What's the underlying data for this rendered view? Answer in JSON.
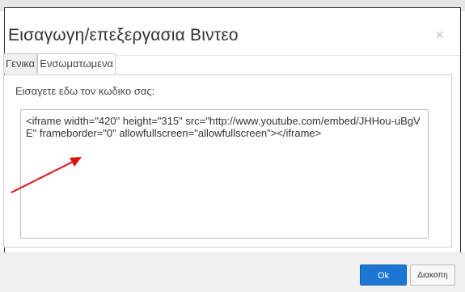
{
  "dialog": {
    "title": "Εισαγωγη/επεξεργασια Βιντεο",
    "close_glyph": "×"
  },
  "tabs": [
    {
      "label": "Γενικα",
      "active": false
    },
    {
      "label": "Ενσωματωμενα",
      "active": true
    }
  ],
  "embed": {
    "label": "Εισαγετε εδω τον κωδικο σας:",
    "code": "<iframe width=\"420\" height=\"315\" src=\"http://www.youtube.com/embed/JHHou-uBgVE\" frameborder=\"0\" allowfullscreen=\"allowfullscreen\"></iframe>"
  },
  "buttons": {
    "ok": "Ok",
    "cancel": "Διακοπη"
  },
  "colors": {
    "primary_button": "#1c76d4",
    "annotation_arrow": "#e01010"
  },
  "icons": {
    "close": "close-icon",
    "annotation": "red-arrow-annotation"
  }
}
